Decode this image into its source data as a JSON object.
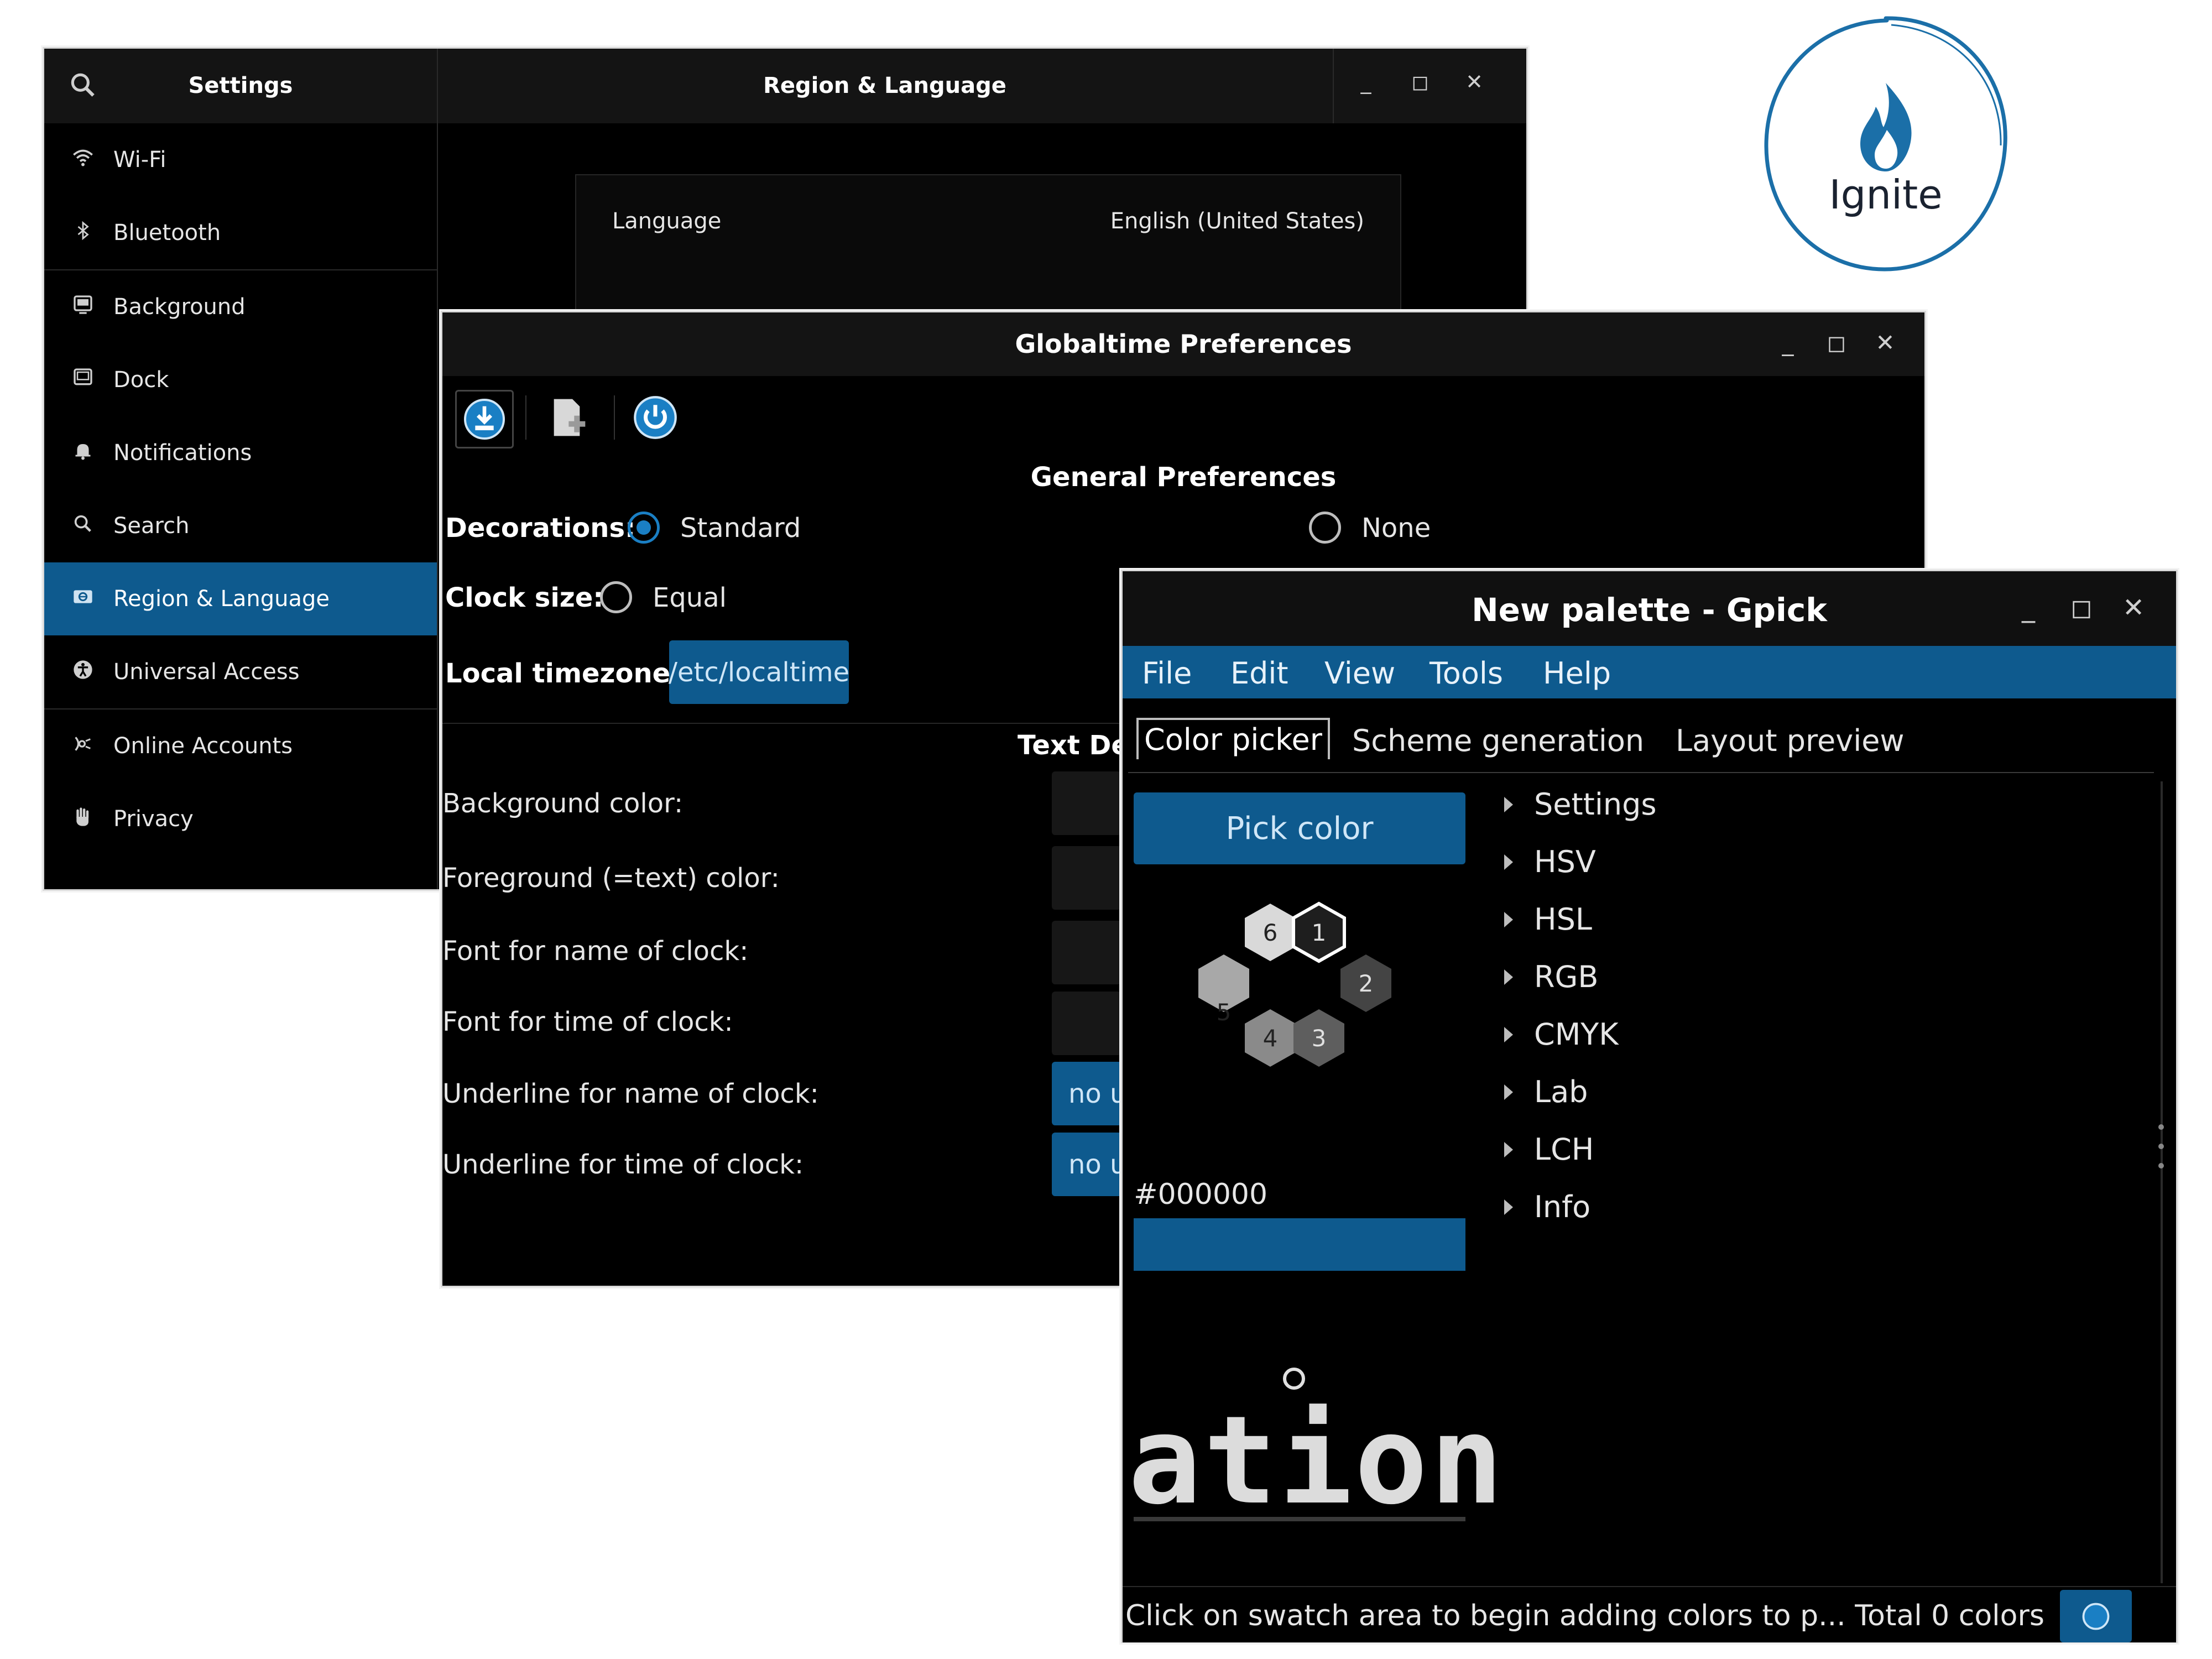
{
  "settings": {
    "sidebar_title": "Settings",
    "main_title": "Region & Language",
    "sidebar": {
      "items": [
        {
          "label": "Wi-Fi",
          "icon": "wifi-icon"
        },
        {
          "label": "Bluetooth",
          "icon": "bluetooth-icon"
        },
        {
          "label": "Background",
          "icon": "background-icon"
        },
        {
          "label": "Dock",
          "icon": "dock-icon"
        },
        {
          "label": "Notifications",
          "icon": "bell-icon"
        },
        {
          "label": "Search",
          "icon": "search-icon"
        },
        {
          "label": "Region & Language",
          "icon": "region-icon",
          "active": true
        },
        {
          "label": "Universal Access",
          "icon": "accessibility-icon"
        },
        {
          "label": "Online Accounts",
          "icon": "online-accounts-icon"
        },
        {
          "label": "Privacy",
          "icon": "hand-icon"
        }
      ]
    },
    "language_label": "Language",
    "language_value": "English (United States)"
  },
  "globaltime": {
    "title": "Globaltime Preferences",
    "section_title": "General Preferences",
    "decorations_label": "Decorations:",
    "decorations_options": [
      "Standard",
      "None"
    ],
    "decorations_selected": "Standard",
    "clock_size_label": "Clock size:",
    "clock_size_option": "Equal",
    "timezone_label": "Local timezone:",
    "timezone_value": "/etc/localtime",
    "text_section": "Text De",
    "fields": [
      {
        "label": "Background color:"
      },
      {
        "label": "Foreground (=text) color:"
      },
      {
        "label": "Font for name of clock:"
      },
      {
        "label": "Font for time of clock:"
      },
      {
        "label": "Underline for name of clock:",
        "value": "no u"
      },
      {
        "label": "Underline for time of clock:",
        "value": "no u"
      }
    ]
  },
  "gpick": {
    "title": "New palette - Gpick",
    "menu": [
      "File",
      "Edit",
      "View",
      "Tools",
      "Help"
    ],
    "tabs": [
      "Color picker",
      "Scheme generation",
      "Layout preview"
    ],
    "active_tab": "Color picker",
    "pick_button": "Pick color",
    "swatches": [
      "1",
      "2",
      "3",
      "4",
      "5",
      "6"
    ],
    "hex_code": "#000000",
    "tree": [
      "Settings",
      "HSV",
      "HSL",
      "RGB",
      "CMYK",
      "Lab",
      "LCH",
      "Info"
    ],
    "zoom_text": "ation",
    "status_text": "Click on swatch area to begin adding colors to p... Total 0 colors"
  },
  "logo": {
    "text": "Ignite",
    "color": "#1b6fa8"
  },
  "colors": {
    "accent": "#0e5a8e",
    "radio_selected": "#1a7fc4",
    "background": "#000000"
  }
}
